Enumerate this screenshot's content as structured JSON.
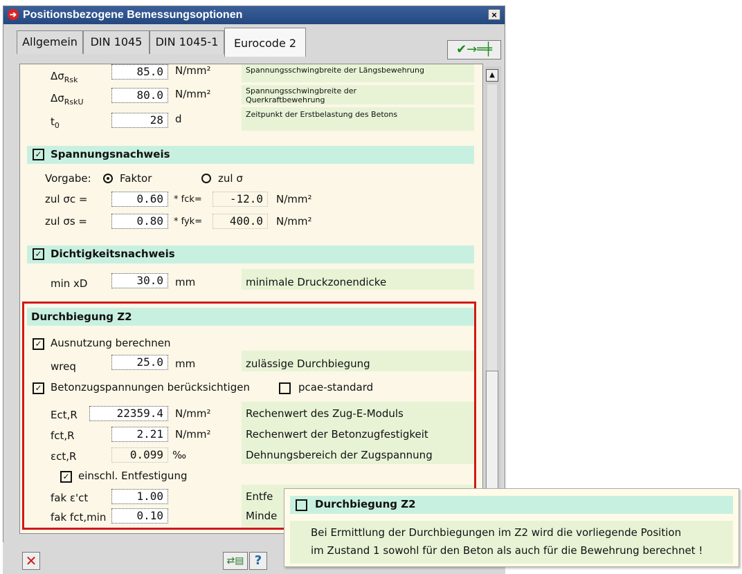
{
  "window": {
    "title": "Positionsbezogene Bemessungsoptionen",
    "close": "×"
  },
  "tabs": [
    "Allgemein",
    "DIN 1045",
    "DIN 1045-1",
    "Eurocode 2"
  ],
  "active_tab": "Eurocode 2",
  "top_rows": [
    {
      "label": "ΔσRsk",
      "value": "85.0",
      "unit": "N/mm²",
      "desc": "Spannungsschwingbreite der Längsbewehrung"
    },
    {
      "label": "ΔσRskU",
      "value": "80.0",
      "unit": "N/mm²",
      "desc": "Spannungsschwingbreite der Querkraftbewehrung"
    },
    {
      "label": "t0",
      "value": "28",
      "unit": "d",
      "desc": "Zeitpunkt der Erstbelastung des Betons"
    }
  ],
  "spannung": {
    "title": "Spannungsnachweis",
    "vorgabe_label": "Vorgabe:",
    "opt_faktor": "Faktor",
    "opt_zul": "zul σ",
    "row1": {
      "label": "zul σc =",
      "value": "0.60",
      "mid": "* fck=",
      "ro": "-12.0",
      "unit": "N/mm²"
    },
    "row2": {
      "label": "zul σs =",
      "value": "0.80",
      "mid": "* fyk=",
      "ro": "400.0",
      "unit": "N/mm²"
    }
  },
  "dicht": {
    "title": "Dichtigkeitsnachweis",
    "label": "min xD",
    "value": "30.0",
    "unit": "mm",
    "desc": "minimale Druckzonendicke"
  },
  "durch": {
    "title": "Durchbiegung Z2",
    "ausnutzung": "Ausnutzung berechnen",
    "wreq": {
      "label": "wreq",
      "value": "25.0",
      "unit": "mm",
      "desc": "zulässige Durchbiegung"
    },
    "beton": "Betonzugspannungen berücksichtigen",
    "pcae": "pcae-standard",
    "rows": [
      {
        "label": "Ect,R",
        "value": "22359.4",
        "unit": "N/mm²",
        "desc": "Rechenwert des Zug-E-Moduls"
      },
      {
        "label": "fct,R",
        "value": "2.21",
        "unit": "N/mm²",
        "desc": "Rechenwert der Betonzugfestigkeit"
      },
      {
        "label": "εct,R",
        "value": "0.099",
        "unit": "‰",
        "desc": "Dehnungsbereich der Zugspannung"
      }
    ],
    "entf": "einschl. Entfestigung",
    "fak1": {
      "label": "fak ε'ct",
      "value": "1.00",
      "desc": "Entfe"
    },
    "fak2": {
      "label": "fak fct,min",
      "value": "0.10",
      "desc": "Minde"
    }
  },
  "tooltip": {
    "title": "Durchbiegung Z2",
    "line1": "Bei Ermittlung der Durchbiegungen im Z2 wird die vorliegende Position",
    "line2": "im Zustand 1 sowohl für den Beton als auch für die Bewehrung berechnet !"
  },
  "colors": {
    "titlebar": "#2f5590",
    "panel": "#fcf7e6",
    "section": "#c8f0e0",
    "desc": "#e8f3d6",
    "highlight": "#d01818"
  }
}
